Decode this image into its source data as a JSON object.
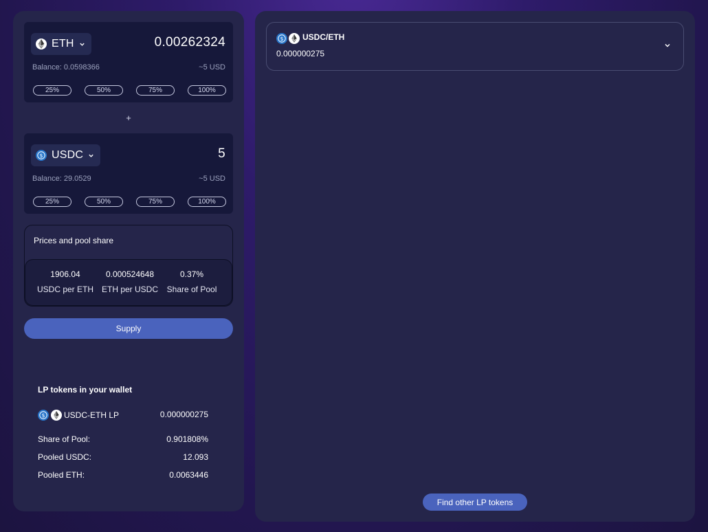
{
  "token_a": {
    "symbol": "ETH",
    "amount": "0.00262324",
    "balance": "Balance: 0.0598366",
    "usd_value": "~5 USD",
    "percent_buttons": [
      "25%",
      "50%",
      "75%",
      "100%"
    ],
    "icon": "eth-icon"
  },
  "plus_sign": "+",
  "token_b": {
    "symbol": "USDC",
    "amount": "5",
    "balance": "Balance: 29.0529",
    "usd_value": "~5 USD",
    "percent_buttons": [
      "25%",
      "50%",
      "75%",
      "100%"
    ],
    "icon": "usdc-icon"
  },
  "prices": {
    "title": "Prices and pool share",
    "items": [
      {
        "value": "1906.04",
        "label": "USDC per ETH"
      },
      {
        "value": "0.000524648",
        "label": "ETH per USDC"
      },
      {
        "value": "0.37%",
        "label": "Share of Pool"
      }
    ]
  },
  "supply_label": "Supply",
  "lp_wallet": {
    "title": "LP tokens in your wallet",
    "pair_label": "USDC-ETH LP",
    "pair_amount": "0.000000275",
    "rows": [
      {
        "label": "Share of Pool:",
        "value": "0.901808%"
      },
      {
        "label": "Pooled USDC:",
        "value": "12.093"
      },
      {
        "label": "Pooled ETH:",
        "value": "0.0063446"
      }
    ]
  },
  "position_card": {
    "pair_name": "USDC/ETH",
    "amount": "0.000000275"
  },
  "find_other_label": "Find other LP tokens",
  "colors": {
    "panel_bg": "#25254a",
    "input_bg": "#16183a",
    "accent_button": "#4a63bd",
    "usdc_blue": "#2775ca"
  }
}
